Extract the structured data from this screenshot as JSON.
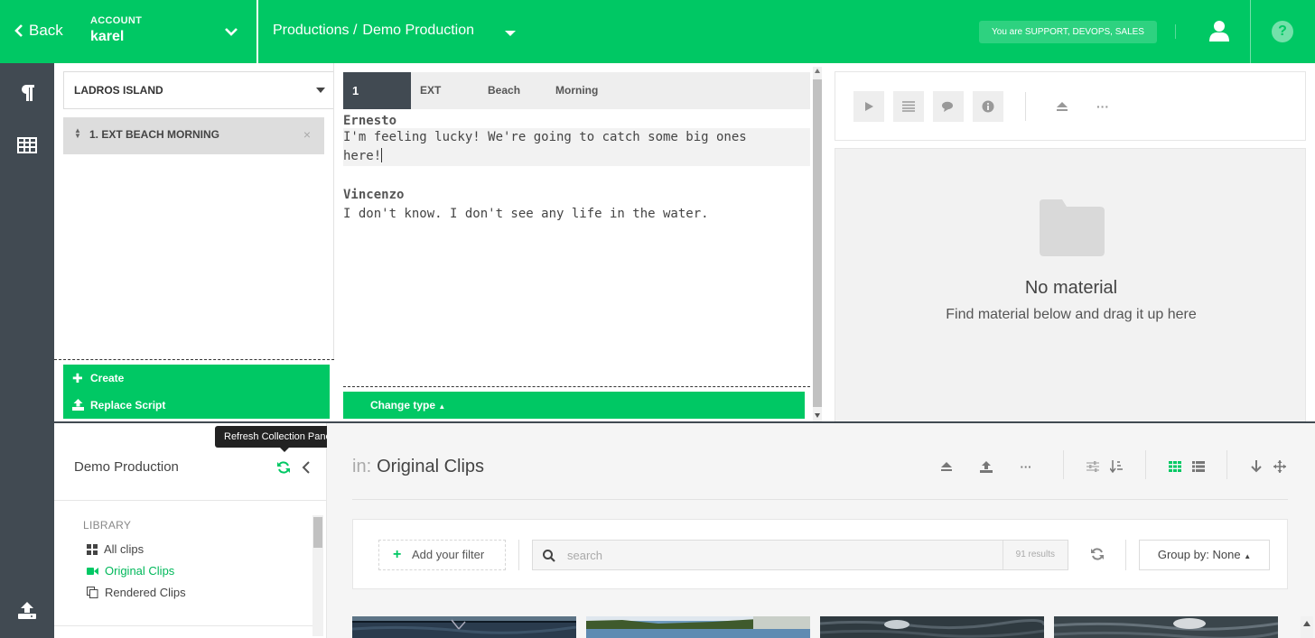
{
  "topbar": {
    "back_label": "Back",
    "account_label": "ACCOUNT",
    "account_name": "karel",
    "breadcrumb_root": "Productions /",
    "breadcrumb_current": "Demo Production",
    "roles_text": "You are SUPPORT, DEVOPS, SALES"
  },
  "rail": {
    "icons": [
      "paragraph-icon",
      "grid-icon",
      "upload-icon"
    ]
  },
  "scenes": {
    "location_select": "LADROS ISLAND",
    "items": [
      {
        "label": "1. EXT BEACH MORNING"
      }
    ],
    "create_label": "Create",
    "replace_label": "Replace Script"
  },
  "editor": {
    "scene_number": "1",
    "scene_tags": [
      "EXT",
      "Beach",
      "Morning"
    ],
    "lines": [
      {
        "character": "Ernesto",
        "text": "I'm feeling lucky! We're going to catch some big ones",
        "text2": "here!"
      },
      {
        "character": "Vincenzo",
        "text": "I don't know. I don't see any life in the water."
      }
    ],
    "change_type_label": "Change type"
  },
  "material": {
    "empty_title": "No material",
    "empty_hint": "Find material below and drag it up here"
  },
  "collection": {
    "title": "Demo Production",
    "tooltip": "Refresh Collection Panel",
    "library_header": "LIBRARY",
    "library_items": [
      {
        "label": "All clips",
        "icon": "grid-icon",
        "active": false
      },
      {
        "label": "Original Clips",
        "icon": "video-camera-icon",
        "active": true
      },
      {
        "label": "Rendered Clips",
        "icon": "copy-icon",
        "active": false
      }
    ]
  },
  "clips": {
    "in_label": "in:",
    "collection_name": "Original Clips",
    "add_filter_label": "Add your filter",
    "search_placeholder": "search",
    "results_text": "91 results",
    "group_by_label": "Group by: None"
  },
  "colors": {
    "brand_green": "#00c864",
    "rail_dark": "#414a52"
  }
}
